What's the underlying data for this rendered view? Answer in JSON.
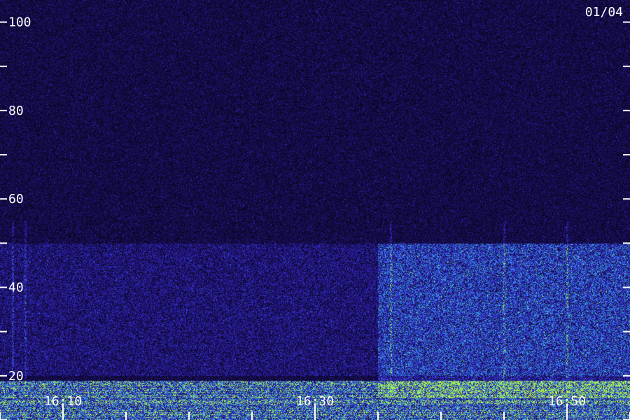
{
  "chart_data": {
    "type": "heatmap",
    "title": "",
    "xlabel": "",
    "ylabel": "",
    "date_label": "01/04",
    "x_axis": {
      "unit": "time (HH:MM)",
      "range": [
        "16:05",
        "16:55"
      ],
      "labeled_ticks": [
        "16:10",
        "16:30",
        "16:50"
      ],
      "minor_tick_step_minutes": 5
    },
    "y_axis": {
      "range": [
        10,
        105
      ],
      "labeled_ticks": [
        20,
        40,
        60,
        80,
        100
      ],
      "minor_tick_step": 10
    },
    "colormap": {
      "low": "#000000",
      "mid_low": "#1a0f5c",
      "mid": "#3a2ee0",
      "mid_high": "#2fa8e8",
      "high": "#b8ff40"
    },
    "features": [
      {
        "kind": "strong band",
        "y_range": [
          10,
          19
        ],
        "x_range": [
          "16:05",
          "16:55"
        ],
        "intensity": "high"
      },
      {
        "kind": "elevated band",
        "y_range": [
          20,
          50
        ],
        "x_range": [
          "16:05",
          "16:55"
        ],
        "intensity": "medium"
      },
      {
        "kind": "brighter patch",
        "y_range": [
          15,
          50
        ],
        "x_range": [
          "16:35",
          "16:55"
        ],
        "intensity": "medium-high"
      },
      {
        "kind": "vertical streak",
        "x": "16:06",
        "y_range": [
          15,
          55
        ]
      },
      {
        "kind": "vertical streak",
        "x": "16:07",
        "y_range": [
          15,
          55
        ]
      },
      {
        "kind": "vertical streak",
        "x": "16:36",
        "y_range": [
          15,
          55
        ]
      },
      {
        "kind": "vertical streak",
        "x": "16:45",
        "y_range": [
          15,
          55
        ]
      },
      {
        "kind": "vertical streak",
        "x": "16:50",
        "y_range": [
          15,
          55
        ]
      }
    ],
    "background": "noise"
  }
}
